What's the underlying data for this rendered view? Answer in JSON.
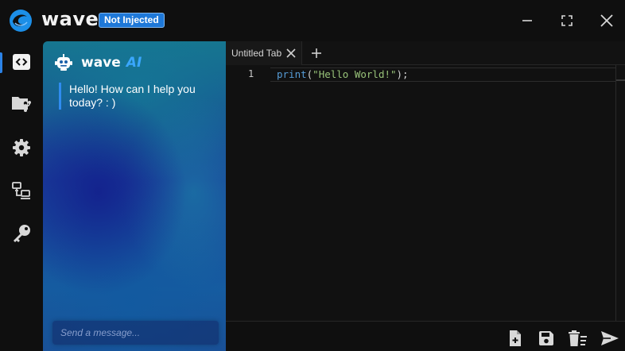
{
  "app": {
    "name": "wave",
    "injection_status": "Not Injected",
    "accent_color": "#2b82e6",
    "badge_color": "#1e78d8"
  },
  "window_controls": [
    {
      "name": "minimize-icon"
    },
    {
      "name": "maximize-icon"
    },
    {
      "name": "close-icon"
    }
  ],
  "sidebar": {
    "items": [
      {
        "name": "code-editor",
        "icon": "code-brackets-icon",
        "active": true
      },
      {
        "name": "script-explorer",
        "icon": "folder-branch-icon",
        "active": false
      },
      {
        "name": "settings",
        "icon": "gear-icon",
        "active": false
      },
      {
        "name": "multi-instance",
        "icon": "computers-icon",
        "active": false
      },
      {
        "name": "key",
        "icon": "key-icon",
        "active": false
      }
    ]
  },
  "ai_panel": {
    "title": "wave",
    "title_accent": "AI",
    "icon": "robot-icon",
    "greeting": "Hello! How can I help you today? : )",
    "input_placeholder": "Send a message..."
  },
  "editor": {
    "tabs": [
      {
        "label": "Untitled Tab",
        "active": true
      }
    ],
    "add_tab_icon": "plus-icon",
    "lines": [
      {
        "number": "1",
        "fn": "print",
        "open": "(",
        "string": "\"Hello World!\"",
        "close": ");"
      }
    ]
  },
  "toolbar": {
    "buttons": [
      {
        "name": "open-file",
        "icon": "file-add-icon"
      },
      {
        "name": "save-file",
        "icon": "save-icon"
      },
      {
        "name": "clear-editor",
        "icon": "trash-lines-icon"
      },
      {
        "name": "execute",
        "icon": "send-icon"
      }
    ]
  }
}
